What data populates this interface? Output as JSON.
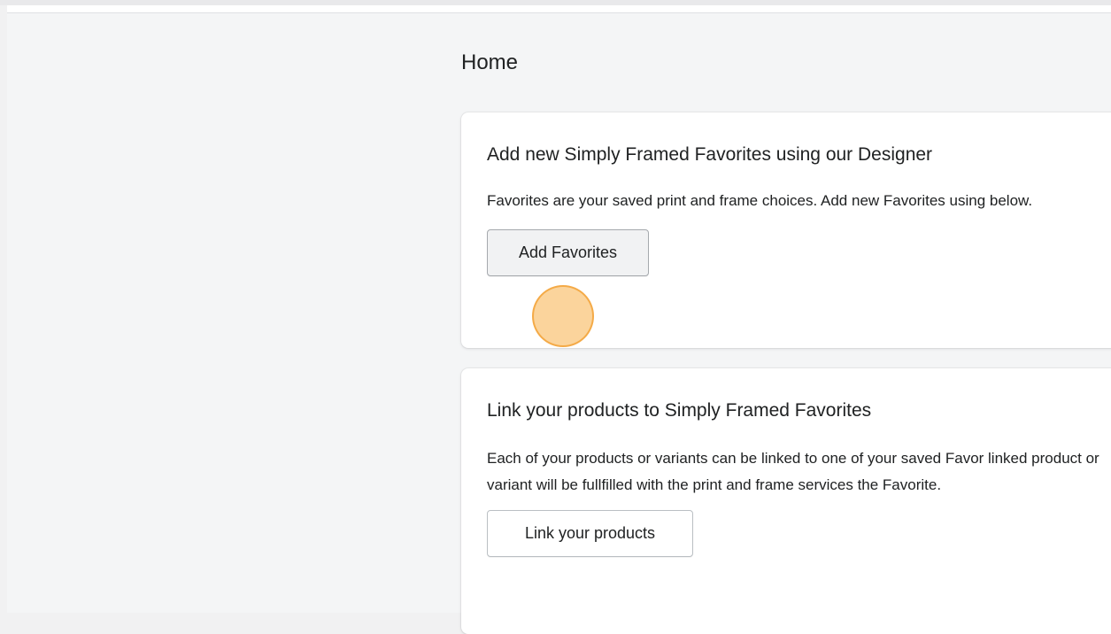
{
  "page": {
    "title": "Home"
  },
  "cards": [
    {
      "title": "Add new Simply Framed Favorites using our Designer",
      "text": "Favorites are your saved print and frame choices. Add new Favorites using below.",
      "button_label": "Add Favorites"
    },
    {
      "title": "Link your products to Simply Framed Favorites",
      "text": "Each of your products or variants can be linked to one of your saved Favor linked product or variant will be fullfilled with the print and frame services the Favorite.",
      "button_label": "Link your products"
    }
  ],
  "colors": {
    "background": "#f4f5f6",
    "card": "#ffffff",
    "text": "#202223",
    "button_border": "#babfc3",
    "click_indicator": "#f7b14a"
  }
}
